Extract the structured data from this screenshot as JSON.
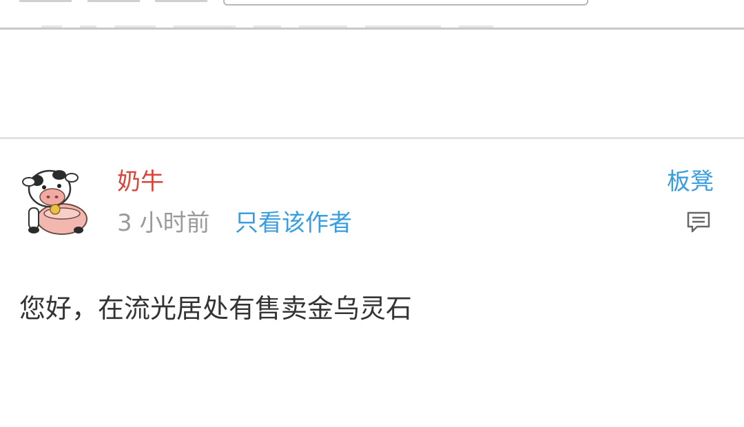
{
  "post": {
    "author": "奶牛",
    "time": "3 小时前",
    "only_author_label": "只看该作者",
    "floor": "板凳",
    "content": "您好，在流光居处有售卖金乌灵石",
    "icons": {
      "avatar": "cow-avatar",
      "reply": "comment-icon"
    }
  },
  "colors": {
    "author": "#d9433a",
    "link": "#3a9de0",
    "meta": "#9a9a9a",
    "text": "#333333",
    "divider": "#e2e2e2"
  }
}
